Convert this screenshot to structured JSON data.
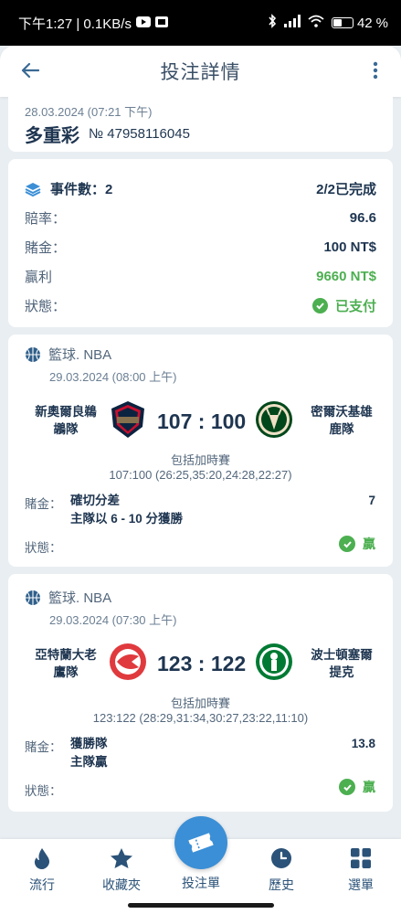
{
  "status_bar": {
    "time_info": "下午1:27 | 0.1KB/s",
    "battery_percent": "42",
    "battery_level": 0.42
  },
  "header": {
    "title": "投注詳情"
  },
  "ticket": {
    "datetime": "28.03.2024 (07:21 下午)",
    "type": "多重彩",
    "number": "№ 47958116045"
  },
  "summary": {
    "events_label": "事件數：2",
    "progress": "2/2已完成",
    "rows": [
      {
        "label": "賠率：",
        "value": "96.6"
      },
      {
        "label": "賭金：",
        "value": "100 NT$"
      },
      {
        "label": "贏利",
        "value": "9660 NT$"
      },
      {
        "label": "狀態：",
        "value": "已支付"
      }
    ]
  },
  "events": [
    {
      "sport": "籃球. NBA",
      "date": "29.03.2024 (08:00 上午)",
      "home_line1": "新奧爾良鵜",
      "home_line2": "鶘隊",
      "score": "107 : 100",
      "away_line1": "密爾沃基雄",
      "away_line2": "鹿隊",
      "note": "包括加時賽",
      "detail": "107:100 (26:25,35:20,24:28,22:27)",
      "bet_label": "賭金：",
      "bet_line1": "確切分差",
      "bet_line2": "主隊以 6 - 10 分獲勝",
      "odds": "7",
      "status_label": "狀態：",
      "result": "贏"
    },
    {
      "sport": "籃球. NBA",
      "date": "29.03.2024 (07:30 上午)",
      "home_line1": "亞特蘭大老",
      "home_line2": "鷹隊",
      "score": "123 : 122",
      "away_line1": "波士頓塞爾",
      "away_line2": "提克",
      "note": "包括加時賽",
      "detail": "123:122 (28:29,31:34,30:27,23:22,11:10)",
      "bet_label": "賭金：",
      "bet_line1": "獲勝隊",
      "bet_line2": "主隊贏",
      "odds": "13.8",
      "status_label": "狀態：",
      "result": "贏"
    }
  ],
  "bottom_nav": {
    "items": [
      "流行",
      "收藏夾",
      "投注單",
      "歷史",
      "選單"
    ]
  },
  "colors": {
    "accent": "#3b8fd6",
    "win": "#4caf50",
    "text": "#1e3550"
  }
}
